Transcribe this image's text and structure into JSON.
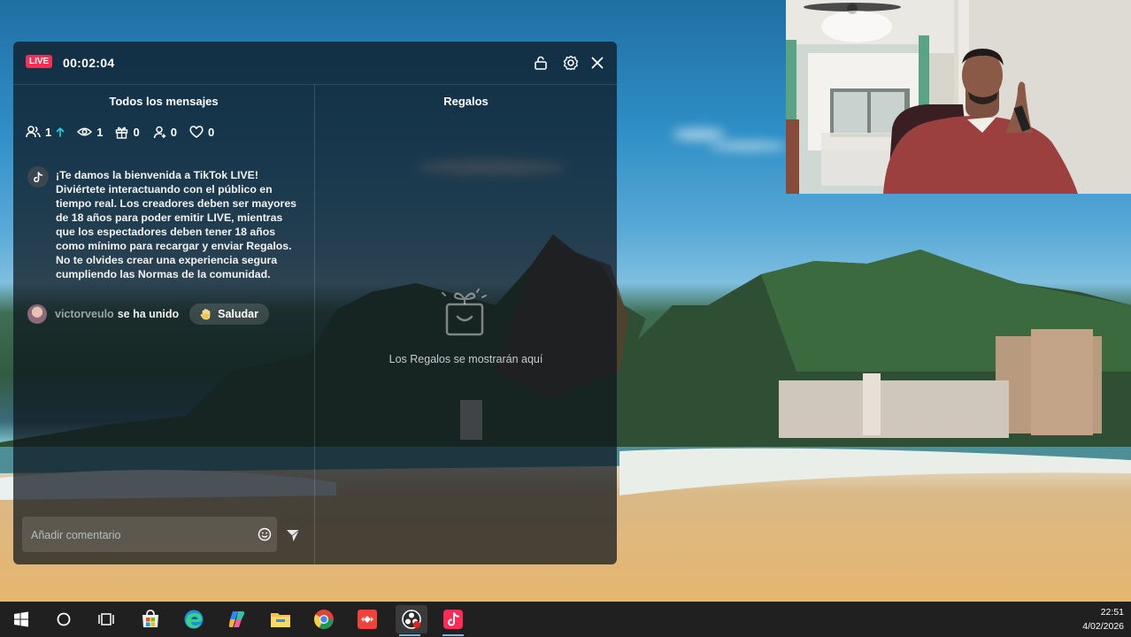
{
  "live_panel": {
    "live_badge": "LIVE",
    "timer": "00:02:04",
    "header_icons": [
      "unlock-icon",
      "settings-icon",
      "close-icon"
    ],
    "messages_title": "Todos los mensajes",
    "gifts_title": "Regalos",
    "stats": {
      "viewers_count": "1",
      "views_count": "1",
      "gifts_count": "0",
      "followers_count": "0",
      "likes_count": "0"
    },
    "welcome_message": "¡Te damos la bienvenida a TikTok LIVE! Diviértete interactuando con el público en tiempo real. Los creadores deben ser mayores de 18 años para poder emitir LIVE, mientras que los espectadores deben tener 18 años como mínimo para recargar y enviar Regalos. No te olvides crear una experiencia segura cumpliendo las Normas de la comunidad.",
    "joined": {
      "username": "victorveulo",
      "text": "se ha unido",
      "greet_button": "Saludar"
    },
    "gifts_empty": "Los Regalos se mostrarán aquí",
    "comment_placeholder": "Añadir comentario"
  },
  "taskbar": {
    "apps": [
      "windows-start",
      "search",
      "task-view",
      "microsoft-store",
      "edge",
      "copilot",
      "file-explorer",
      "chrome",
      "anydesk",
      "obs",
      "tiktok-live-studio"
    ],
    "time": "22:51",
    "date": "4/02/2026"
  },
  "colors": {
    "live_badge": "#fe2c55",
    "panel_bg": "#0c141c",
    "taskbar": "#202020",
    "accent_up": "#20d5ec"
  }
}
